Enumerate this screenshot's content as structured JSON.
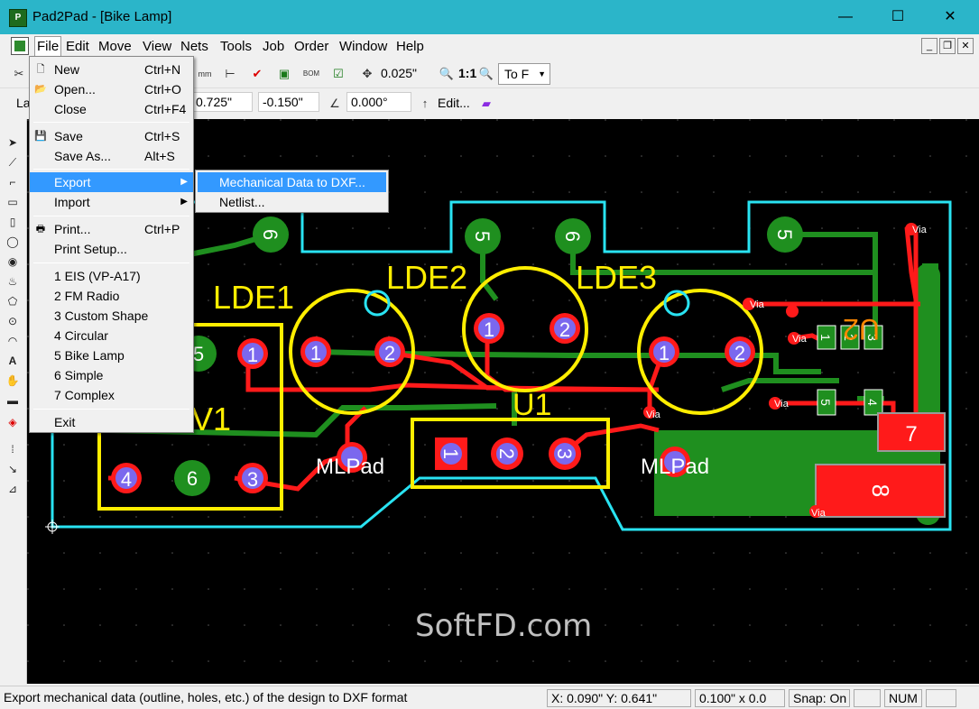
{
  "window": {
    "title": "Pad2Pad - [Bike Lamp]",
    "icon": "pad2pad-app-icon",
    "minimize": "—",
    "maximize": "☐",
    "close": "✕"
  },
  "menubar": {
    "items": [
      {
        "label": "File"
      },
      {
        "label": "Edit"
      },
      {
        "label": "Move"
      },
      {
        "label": "View"
      },
      {
        "label": "Nets"
      },
      {
        "label": "Tools"
      },
      {
        "label": "Job"
      },
      {
        "label": "Order"
      },
      {
        "label": "Window"
      },
      {
        "label": "Help"
      }
    ]
  },
  "toolbar1": {
    "grid_value": "0.025\"",
    "zoom_label": "1:1",
    "fit_dropdown": "To F"
  },
  "toolbar2": {
    "layer_label": "La",
    "x_value": "0.725\"",
    "y_value": "-0.150\"",
    "angle_value": "0.000°",
    "edit_label": "Edit..."
  },
  "file_menu": {
    "items": [
      {
        "label": "New",
        "shortcut": "Ctrl+N",
        "icon": "new-file-icon"
      },
      {
        "label": "Open...",
        "shortcut": "Ctrl+O",
        "icon": "open-folder-icon"
      },
      {
        "label": "Close",
        "shortcut": "Ctrl+F4"
      },
      {
        "label": "Save",
        "shortcut": "Ctrl+S",
        "icon": "save-disk-icon"
      },
      {
        "label": "Save As...",
        "shortcut": "Alt+S"
      },
      {
        "label": "Export",
        "submenu": true
      },
      {
        "label": "Import",
        "submenu": true
      },
      {
        "label": "Print...",
        "shortcut": "Ctrl+P",
        "icon": "printer-icon"
      },
      {
        "label": "Print Setup..."
      },
      {
        "label": "1 EIS (VP-A17)"
      },
      {
        "label": "2 FM Radio"
      },
      {
        "label": "3 Custom Shape"
      },
      {
        "label": "4 Circular"
      },
      {
        "label": "5 Bike Lamp"
      },
      {
        "label": "6 Simple"
      },
      {
        "label": "7 Complex"
      },
      {
        "label": "Exit"
      }
    ]
  },
  "export_submenu": {
    "items": [
      {
        "label": "Mechanical Data to DXF..."
      },
      {
        "label": "Netlist..."
      }
    ]
  },
  "canvas": {
    "labels": {
      "lde1": "LDE1",
      "lde2": "LDE2",
      "lde3": "LDE3",
      "u1": "U1",
      "u2": "U2",
      "v1": "V1",
      "mlpad_left": "MLPad",
      "mlpad_right": "MLPad",
      "via": "Via",
      "watermark": "SoftFD.com"
    },
    "colors": {
      "background": "#000000",
      "outline": "#29e3f2",
      "silk": "#ffee00",
      "top_trace": "#ff1a1a",
      "bottom_trace": "#1f8f1f",
      "pad_fill": "#7b68ee"
    }
  },
  "status": {
    "message": "Export mechanical data (outline, holes, etc.) of the design to DXF format",
    "coords": "X: 0.090\" Y: 0.641\"",
    "grid": "0.100\" x 0.0",
    "snap": "Snap: On",
    "num": "NUM"
  }
}
